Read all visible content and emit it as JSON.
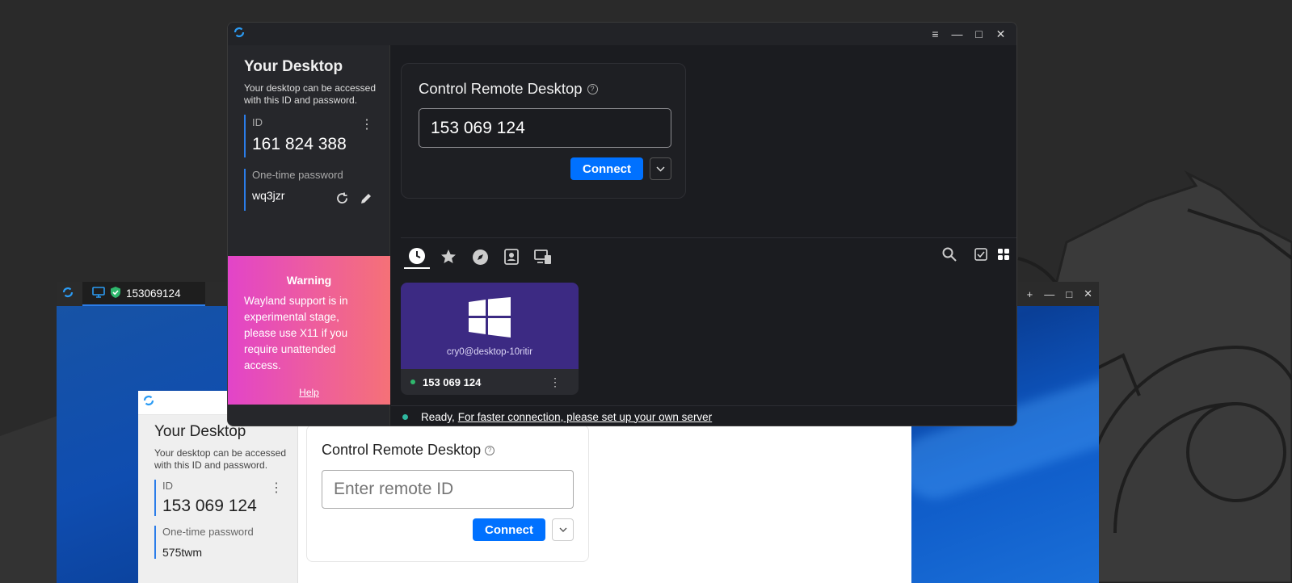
{
  "colors": {
    "accent": "#0071ff",
    "id_border": "#2b7de9",
    "warning_start": "#e244c9",
    "warning_end": "#f57177",
    "peer_bg": "#3c2a83"
  },
  "remote_session": {
    "tab_label": "153069124",
    "icons": [
      "rustdesk-logo-icon",
      "monitor-icon",
      "shield-check-icon"
    ],
    "controls": [
      "plus-icon",
      "minimize-icon",
      "maximize-icon",
      "close-icon"
    ]
  },
  "inner_app": {
    "sidebar": {
      "title": "Your Desktop",
      "desc": "Your desktop can be accessed with this ID and password.",
      "id_label": "ID",
      "id_value": "153 069 124",
      "pw_label": "One-time password",
      "pw_value": "575twm"
    },
    "main": {
      "title": "Control Remote Desktop",
      "input_placeholder": "Enter remote ID",
      "connect_label": "Connect"
    }
  },
  "main_app": {
    "window_controls": [
      "menu-icon",
      "minimize-icon",
      "maximize-icon",
      "close-icon"
    ],
    "sidebar": {
      "title": "Your Desktop",
      "desc": "Your desktop can be accessed with this ID and password.",
      "id_label": "ID",
      "id_value": "161 824 388",
      "pw_label": "One-time password",
      "pw_value": "wq3jzr"
    },
    "warning": {
      "title": "Warning",
      "body": "Wayland support is in experimental stage, please use X11 if you require unattended access.",
      "help": "Help"
    },
    "control": {
      "title": "Control Remote Desktop",
      "input_value": "153 069 124",
      "connect_label": "Connect"
    },
    "tabs": [
      "recent-sessions-icon",
      "favorites-icon",
      "discovered-icon",
      "address-book-icon",
      "accessible-devices-icon"
    ],
    "peer": {
      "user": "cry0@desktop-10ritir",
      "id": "153 069 124",
      "os_icon": "windows-icon"
    },
    "status": {
      "text": "Ready,",
      "link": "For faster connection, please set up your own server"
    }
  }
}
